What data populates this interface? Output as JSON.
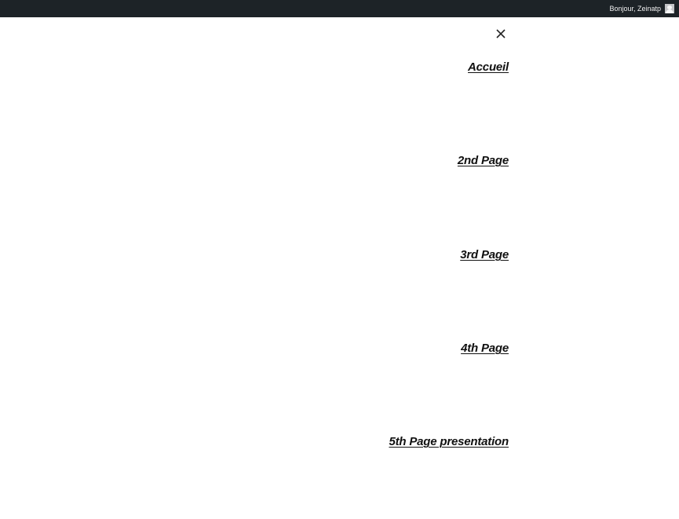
{
  "admin_bar": {
    "greeting": "Bonjour, Zeinatp",
    "avatar_icon": "avatar-icon",
    "background_color": "#1d2327"
  },
  "close_icon": "close-icon",
  "menu": {
    "items": [
      {
        "label": "Accueil"
      },
      {
        "label": "2nd Page"
      },
      {
        "label": "3rd Page"
      },
      {
        "label": "4th Page"
      },
      {
        "label": "5th Page presentation"
      }
    ]
  }
}
